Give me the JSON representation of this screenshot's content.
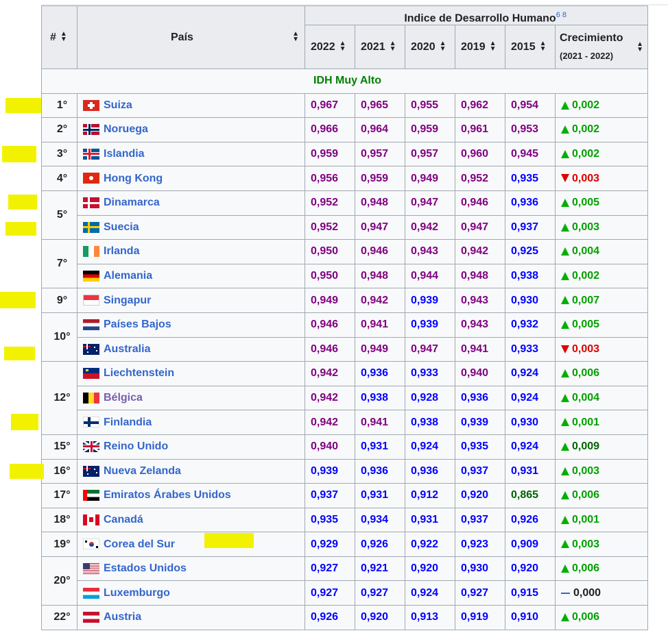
{
  "header": {
    "rank": "#",
    "country": "País",
    "idh_title": "Indice de Desarrollo Humano",
    "refs": "6 8",
    "years": [
      "2022",
      "2021",
      "2020",
      "2019",
      "2015"
    ],
    "growth": "Crecimiento",
    "growth_sub": "(2021 - 2022)"
  },
  "group_label": "IDH Muy Alto",
  "rows": [
    {
      "rank": "1°",
      "country": "Suiza",
      "flag": "switzerland-flag",
      "v": [
        "0,967",
        "0,965",
        "0,955",
        "0,962",
        "0,954"
      ],
      "g": "0,002",
      "dir": "up"
    },
    {
      "rank": "2°",
      "country": "Noruega",
      "flag": "norway-flag",
      "v": [
        "0,966",
        "0,964",
        "0,959",
        "0,961",
        "0,953"
      ],
      "g": "0,002",
      "dir": "up"
    },
    {
      "rank": "3°",
      "country": "Islandia",
      "flag": "iceland-flag",
      "v": [
        "0,959",
        "0,957",
        "0,957",
        "0,960",
        "0,945"
      ],
      "g": "0,002",
      "dir": "up"
    },
    {
      "rank": "4°",
      "country": "Hong Kong",
      "flag": "hong-kong-flag",
      "v": [
        "0,956",
        "0,959",
        "0,949",
        "0,952",
        "0,935"
      ],
      "g": "0,003",
      "dir": "down"
    },
    {
      "rank": "5°",
      "country": "Dinamarca",
      "flag": "denmark-flag",
      "v": [
        "0,952",
        "0,948",
        "0,947",
        "0,946",
        "0,936"
      ],
      "g": "0,005",
      "dir": "up"
    },
    {
      "rank": "",
      "country": "Suecia",
      "flag": "sweden-flag",
      "v": [
        "0,952",
        "0,947",
        "0,942",
        "0,947",
        "0,937"
      ],
      "g": "0,003",
      "dir": "up"
    },
    {
      "rank": "7°",
      "country": "Irlanda",
      "flag": "ireland-flag",
      "v": [
        "0,950",
        "0,946",
        "0,943",
        "0,942",
        "0,925"
      ],
      "g": "0,004",
      "dir": "up"
    },
    {
      "rank": "",
      "country": "Alemania",
      "flag": "germany-flag",
      "v": [
        "0,950",
        "0,948",
        "0,944",
        "0,948",
        "0,938"
      ],
      "g": "0,002",
      "dir": "up"
    },
    {
      "rank": "9°",
      "country": "Singapur",
      "flag": "singapore-flag",
      "v": [
        "0,949",
        "0,942",
        "0,939",
        "0,943",
        "0,930"
      ],
      "g": "0,007",
      "dir": "up"
    },
    {
      "rank": "10°",
      "country": "Países Bajos",
      "flag": "netherlands-flag",
      "v": [
        "0,946",
        "0,941",
        "0,939",
        "0,943",
        "0,932"
      ],
      "g": "0,005",
      "dir": "up"
    },
    {
      "rank": "",
      "country": "Australia",
      "flag": "australia-flag",
      "v": [
        "0,946",
        "0,949",
        "0,947",
        "0,941",
        "0,933"
      ],
      "g": "0,003",
      "dir": "down"
    },
    {
      "rank": "12°",
      "country": "Liechtenstein",
      "flag": "liechtenstein-flag",
      "v": [
        "0,942",
        "0,936",
        "0,933",
        "0,940",
        "0,924"
      ],
      "g": "0,006",
      "dir": "up"
    },
    {
      "rank": "",
      "country": "Bélgica",
      "flag": "belgium-flag",
      "v": [
        "0,942",
        "0,938",
        "0,928",
        "0,936",
        "0,924"
      ],
      "g": "0,004",
      "dir": "up"
    },
    {
      "rank": "",
      "country": "Finlandia",
      "flag": "finland-flag",
      "v": [
        "0,942",
        "0,941",
        "0,938",
        "0,939",
        "0,930"
      ],
      "g": "0,001",
      "dir": "up"
    },
    {
      "rank": "15°",
      "country": "Reino Unido",
      "flag": "united-kingdom-flag",
      "v": [
        "0,940",
        "0,931",
        "0,924",
        "0,935",
        "0,924"
      ],
      "g": "0,009",
      "dir": "up"
    },
    {
      "rank": "16°",
      "country": "Nueva Zelanda",
      "flag": "new-zealand-flag",
      "v": [
        "0,939",
        "0,936",
        "0,936",
        "0,937",
        "0,931"
      ],
      "g": "0,003",
      "dir": "up"
    },
    {
      "rank": "17°",
      "country": "Emiratos Árabes Unidos",
      "flag": "uae-flag",
      "v": [
        "0,937",
        "0,931",
        "0,912",
        "0,920",
        "0,865"
      ],
      "g": "0,006",
      "dir": "up"
    },
    {
      "rank": "18°",
      "country": "Canadá",
      "flag": "canada-flag",
      "v": [
        "0,935",
        "0,934",
        "0,931",
        "0,937",
        "0,926"
      ],
      "g": "0,001",
      "dir": "up"
    },
    {
      "rank": "19°",
      "country": "Corea del Sur",
      "flag": "south-korea-flag",
      "v": [
        "0,929",
        "0,926",
        "0,922",
        "0,923",
        "0,909"
      ],
      "g": "0,003",
      "dir": "up"
    },
    {
      "rank": "20°",
      "country": "Estados Unidos",
      "flag": "united-states-flag",
      "v": [
        "0,927",
        "0,921",
        "0,920",
        "0,930",
        "0,920"
      ],
      "g": "0,006",
      "dir": "up"
    },
    {
      "rank": "",
      "country": "Luxemburgo",
      "flag": "luxembourg-flag",
      "v": [
        "0,927",
        "0,927",
        "0,924",
        "0,927",
        "0,915"
      ],
      "g": "0,000",
      "dir": "flat"
    },
    {
      "rank": "22°",
      "country": "Austria",
      "flag": "austria-flag",
      "v": [
        "0,926",
        "0,920",
        "0,913",
        "0,919",
        "0,910"
      ],
      "g": "0,006",
      "dir": "up"
    }
  ],
  "colors": {
    "purple": "#800080",
    "blue": "#0000ff",
    "dark_green": "#006400",
    "up": "#00a000",
    "down": "#dd0000",
    "link": "#3366cc",
    "highlight": "#f2f200"
  }
}
